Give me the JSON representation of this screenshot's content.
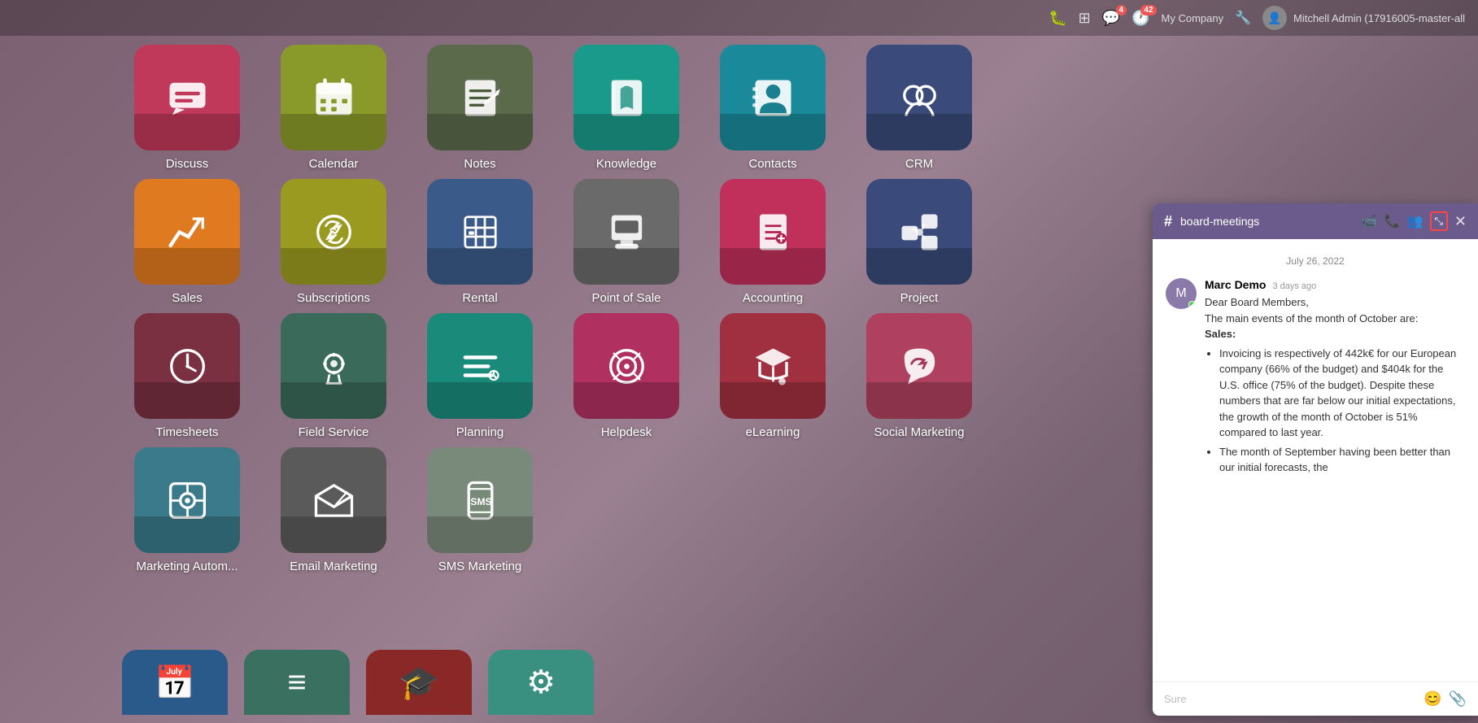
{
  "topnav": {
    "bug_icon": "🐛",
    "grid_icon": "⊞",
    "chat_count": "4",
    "clock_count": "42",
    "company": "My Company",
    "wrench_icon": "🔧",
    "user_name": "Mitchell Admin (17916005-master-all",
    "user_avatar": "👤"
  },
  "apps": [
    {
      "id": "discuss",
      "label": "Discuss",
      "color": "#c0395a",
      "icon": "💬"
    },
    {
      "id": "calendar",
      "label": "Calendar",
      "color": "#8a9a2a",
      "icon": "📅"
    },
    {
      "id": "notes",
      "label": "Notes",
      "color": "#5a6a4a",
      "icon": "📝"
    },
    {
      "id": "knowledge",
      "label": "Knowledge",
      "color": "#1a9a8a",
      "icon": "📖"
    },
    {
      "id": "contacts",
      "label": "Contacts",
      "color": "#1a8a9a",
      "icon": "👤"
    },
    {
      "id": "crm",
      "label": "CRM",
      "color": "#3a4a7a",
      "icon": "🤝"
    },
    {
      "id": "sales",
      "label": "Sales",
      "color": "#e07a20",
      "icon": "📈"
    },
    {
      "id": "subscriptions",
      "label": "Subscriptions",
      "color": "#9a9a20",
      "icon": "💲"
    },
    {
      "id": "rental",
      "label": "Rental",
      "color": "#3a5a8a",
      "icon": "🏢"
    },
    {
      "id": "pos",
      "label": "Point of Sale",
      "color": "#6a6a6a",
      "icon": "🏪"
    },
    {
      "id": "accounting",
      "label": "Accounting",
      "color": "#c0305a",
      "icon": "📋"
    },
    {
      "id": "project",
      "label": "Project",
      "color": "#3a4a7a",
      "icon": "🧩"
    },
    {
      "id": "timesheets",
      "label": "Timesheets",
      "color": "#7a3040",
      "icon": "⏱"
    },
    {
      "id": "fieldservice",
      "label": "Field Service",
      "color": "#3a6a5a",
      "icon": "⚙"
    },
    {
      "id": "planning",
      "label": "Planning",
      "color": "#1a8a7a",
      "icon": "☰"
    },
    {
      "id": "helpdesk",
      "label": "Helpdesk",
      "color": "#b03060",
      "icon": "🛟"
    },
    {
      "id": "elearning",
      "label": "eLearning",
      "color": "#a03040",
      "icon": "🎓"
    },
    {
      "id": "socialmarketing",
      "label": "Social Marketing",
      "color": "#b04060",
      "icon": "👍"
    },
    {
      "id": "marketingauto",
      "label": "Marketing Autom...",
      "color": "#3a7a8a",
      "icon": "⚙"
    },
    {
      "id": "emailmarketing",
      "label": "Email Marketing",
      "color": "#5a5a5a",
      "icon": "✈"
    },
    {
      "id": "smsmarketing",
      "label": "SMS Marketing",
      "color": "#7a8a7a",
      "icon": "📱"
    }
  ],
  "bottom_apps": [
    {
      "id": "bottom1",
      "color": "#2a5a8a",
      "icon": "📅"
    },
    {
      "id": "bottom2",
      "color": "#3a7a6a",
      "icon": "≡"
    },
    {
      "id": "bottom3",
      "color": "#8a3030",
      "icon": "🎓"
    }
  ],
  "chat": {
    "channel": "board-meetings",
    "date_divider": "July 26, 2022",
    "messages": [
      {
        "author": "Marc Demo",
        "time": "3 days ago",
        "avatar_color": "#7a6090",
        "text_parts": [
          "Dear Board Members,",
          "The main events of the month of October are:",
          "Sales:",
          "Invoicing is respectively of 442k€ for our European company (66% of the budget) and $404k for the U.S. office (75% of the budget). Despite these numbers that are far below our initial expectations, the growth of the month of October is 51% compared to last year.",
          "The month of September having been better than our initial forecasts, the"
        ]
      }
    ],
    "input_placeholder": "Sure",
    "emoji_icon": "😊",
    "attachment_icon": "📎"
  }
}
